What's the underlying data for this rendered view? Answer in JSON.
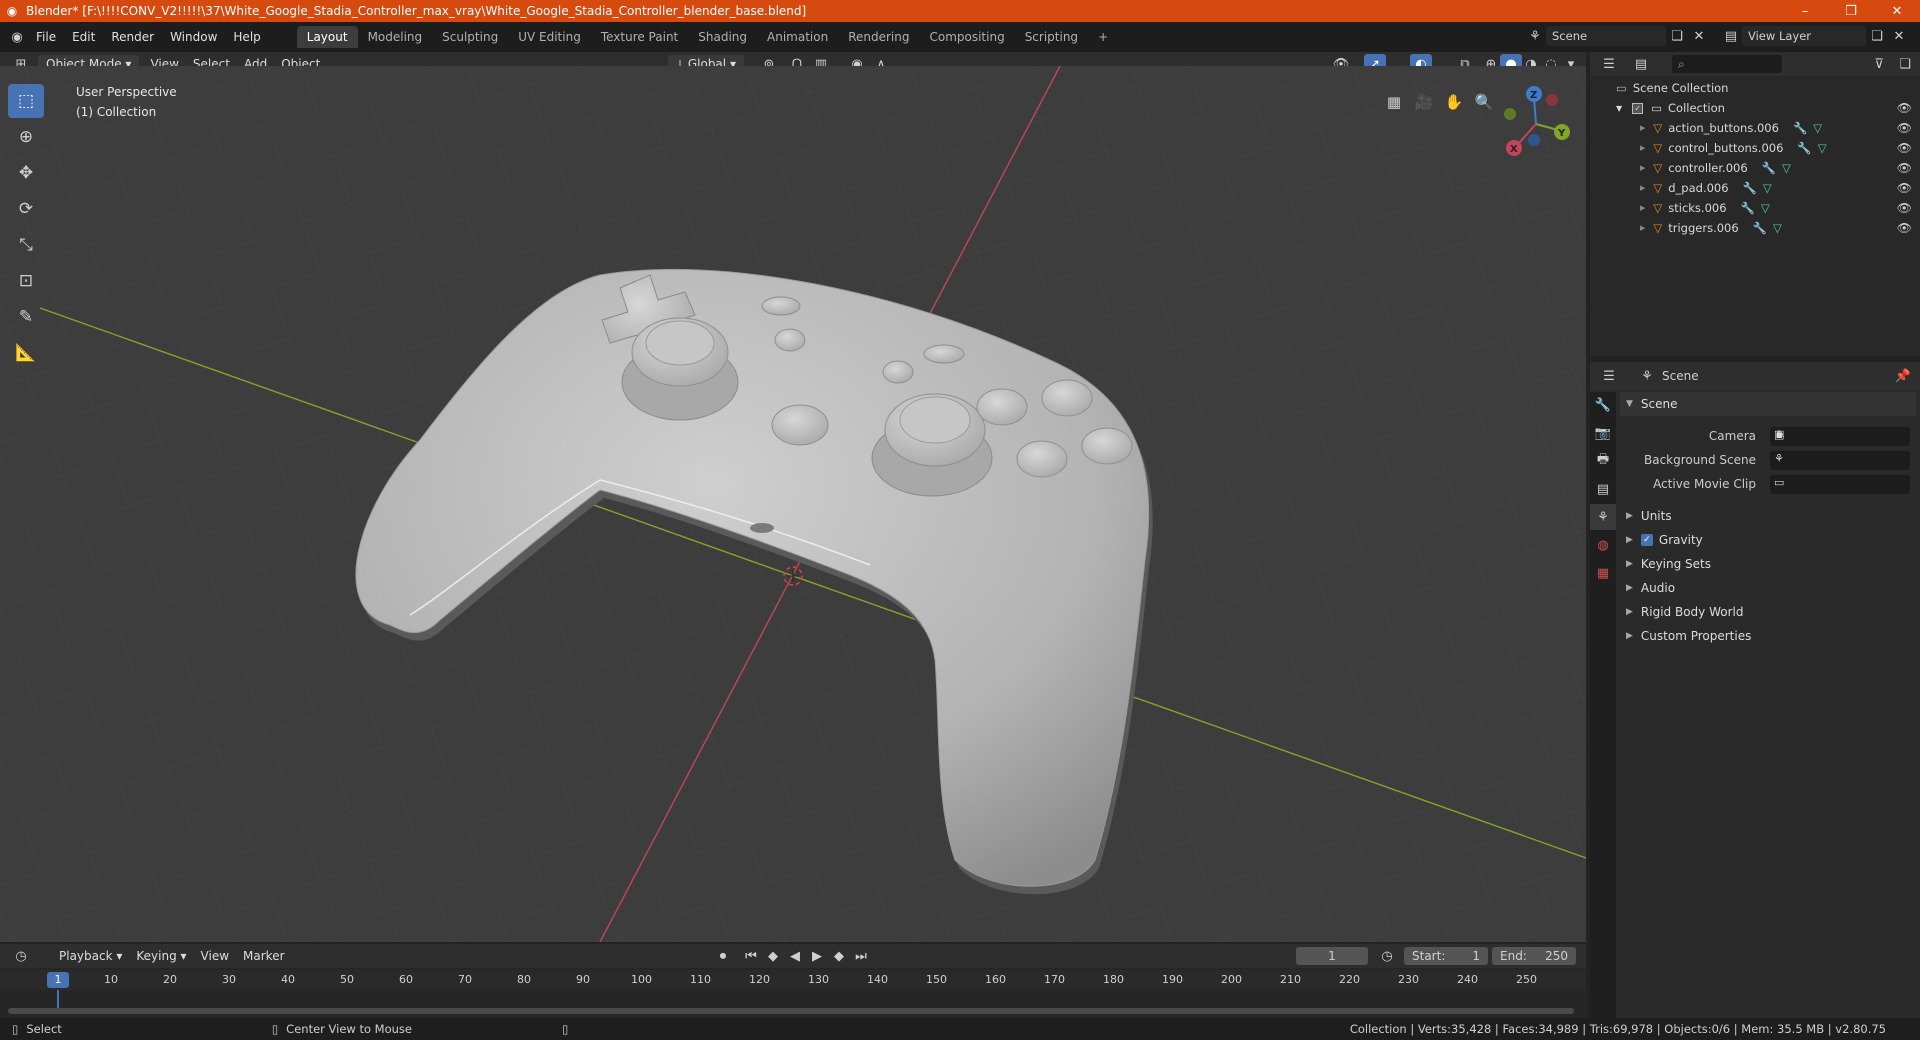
{
  "window": {
    "title": "Blender* [F:\\!!!!CONV_V2!!!!!\\37\\White_Google_Stadia_Controller_max_vray\\White_Google_Stadia_Controller_blender_base.blend]",
    "controls": [
      "–",
      "❐",
      "✕"
    ]
  },
  "menu": [
    "File",
    "Edit",
    "Render",
    "Window",
    "Help"
  ],
  "workspaces": [
    {
      "label": "Layout",
      "active": true
    },
    {
      "label": "Modeling",
      "active": false
    },
    {
      "label": "Sculpting",
      "active": false
    },
    {
      "label": "UV Editing",
      "active": false
    },
    {
      "label": "Texture Paint",
      "active": false
    },
    {
      "label": "Shading",
      "active": false
    },
    {
      "label": "Animation",
      "active": false
    },
    {
      "label": "Rendering",
      "active": false
    },
    {
      "label": "Compositing",
      "active": false
    },
    {
      "label": "Scripting",
      "active": false
    }
  ],
  "add_workspace": "+",
  "scene_selector": "Scene",
  "view_layer": "View Layer",
  "viewport_header": {
    "mode": "Object Mode",
    "menus": [
      "View",
      "Select",
      "Add",
      "Object"
    ],
    "transform_orientation": "Global"
  },
  "viewport": {
    "perspective": "User Perspective",
    "collection": "(1) Collection",
    "gizmo": {
      "x": "X",
      "y": "Y",
      "z": "Z"
    },
    "colors": {
      "x_axis": "#c2455a",
      "y_axis": "#80a62a",
      "z_axis": "#3b7ed0",
      "model": "#b5b5b5",
      "background": "#3d3d3d"
    }
  },
  "outliner": {
    "root": "Scene Collection",
    "collection": "Collection",
    "objects": [
      "action_buttons.006",
      "control_buttons.006",
      "controller.006",
      "d_pad.006",
      "sticks.006",
      "triggers.006"
    ]
  },
  "properties": {
    "context": "Scene",
    "panel_open": "Scene",
    "fields": [
      {
        "label": "Camera",
        "value": ""
      },
      {
        "label": "Background Scene",
        "value": ""
      },
      {
        "label": "Active Movie Clip",
        "value": ""
      }
    ],
    "subpanels": [
      {
        "label": "Units",
        "checkbox": false
      },
      {
        "label": "Gravity",
        "checkbox": true,
        "checked": true
      },
      {
        "label": "Keying Sets",
        "checkbox": false
      },
      {
        "label": "Audio",
        "checkbox": false
      },
      {
        "label": "Rigid Body World",
        "checkbox": false
      },
      {
        "label": "Custom Properties",
        "checkbox": false
      }
    ]
  },
  "timeline": {
    "menus": [
      "Playback",
      "Keying",
      "View",
      "Marker"
    ],
    "current_frame": "1",
    "start_label": "Start:",
    "start": "1",
    "end_label": "End:",
    "end": "250",
    "ticks": [
      "1",
      "10",
      "20",
      "30",
      "40",
      "50",
      "60",
      "70",
      "80",
      "90",
      "100",
      "110",
      "120",
      "130",
      "140",
      "150",
      "160",
      "170",
      "180",
      "190",
      "200",
      "210",
      "220",
      "230",
      "240",
      "250"
    ]
  },
  "status": {
    "left": "Select",
    "middle": "Center View to Mouse",
    "stats": "Collection | Verts:35,428 | Faces:34,989 | Tris:69,978 | Objects:0/6 | Mem: 35.5 MB | v2.80.75"
  }
}
